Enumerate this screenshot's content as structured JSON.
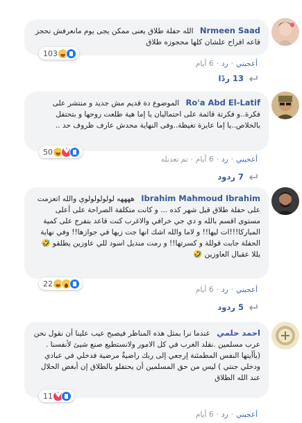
{
  "comments": [
    {
      "author": "Nrmeen Saad",
      "text": "الله حفلة طلاق يعنى ممكن يجى يوم مانعرفش نحجز قاعه افراح علشان كلها محجوزه طلاق",
      "reactions_count": "103",
      "reaction_icons": [
        "like-icon",
        "haha-icon"
      ],
      "actions": {
        "like": "أعجبني",
        "reply": "رد",
        "time": "6 أيام"
      },
      "replies_label": "13 ردًا"
    },
    {
      "author": "Ro'a Abd El-Latif",
      "text": "الموضوع دة قديم مش جديد و منتشر على فكرة..و فكرتة قائمة على احتماليان يا إما هية طلعت روحها و بتحتفل بالخلاص..يا إما عايزة تغيظة..وفى النهاية محدش عارف ظروف حد ..",
      "reactions_count": "50",
      "reaction_icons": [
        "like-icon",
        "love-icon",
        "haha-icon"
      ],
      "actions": {
        "like": "أعجبني",
        "reply": "رد",
        "time": "6 أيام",
        "edited": "تم تعديله"
      },
      "replies_label": "7 ردود"
    },
    {
      "author": "Ibrahim Mahmoud Ibrahim",
      "text": "ههههه لولولولولوي والله اتعزمت على حفلة طلاق قبل شهر كده ... و كانت متكلفة الصراحة على أعلى مستوى اقسم بالله و دي جي خرافي والاغرب كنت قاعد بتفرج على كمية المباركا!!!ات ليها!! و لاما والله اشك انها جت زيها في جوازها!! وفي نهاية الحفلة جابت قوللة و كسرتها!! و رمت منديل اسود للي عاوزين يطلقو 🤣 يللا عقبال العاوزين 🤣",
      "reactions_count": "22",
      "reaction_icons": [
        "like-icon",
        "wow-icon",
        "haha-icon"
      ],
      "actions": {
        "like": "أعجبني",
        "reply": "رد",
        "time": "6 أيام"
      },
      "replies_label": "5 ردود"
    },
    {
      "author": "احمد حلمي",
      "text": "عندما نرا بمثل هذه المناظر فيصبح عيب علينا أن نقول نحن عرب مسلمين .نقلد الغرب في كل الامور ولانستطيع صنع شيئ لأنفسنا .(يأأيتها النفس المطمئنة إرجعي إلى ربك راضيةٌ مرضية فدخلي في عبادي ودخلي جنتي ) ليس من حق المسلمين أن يحتفلو بالطلاق إن أبغض الحلال عند الله الطلاق",
      "reactions_count": "11",
      "reaction_icons": [
        "like-icon",
        "love-icon"
      ],
      "actions": {
        "like": "أعجبني",
        "reply": "رد",
        "time": "6 أيام"
      }
    }
  ],
  "colors": {
    "link": "#385898",
    "bubble": "#f2f3f5",
    "meta": "#90949c"
  }
}
